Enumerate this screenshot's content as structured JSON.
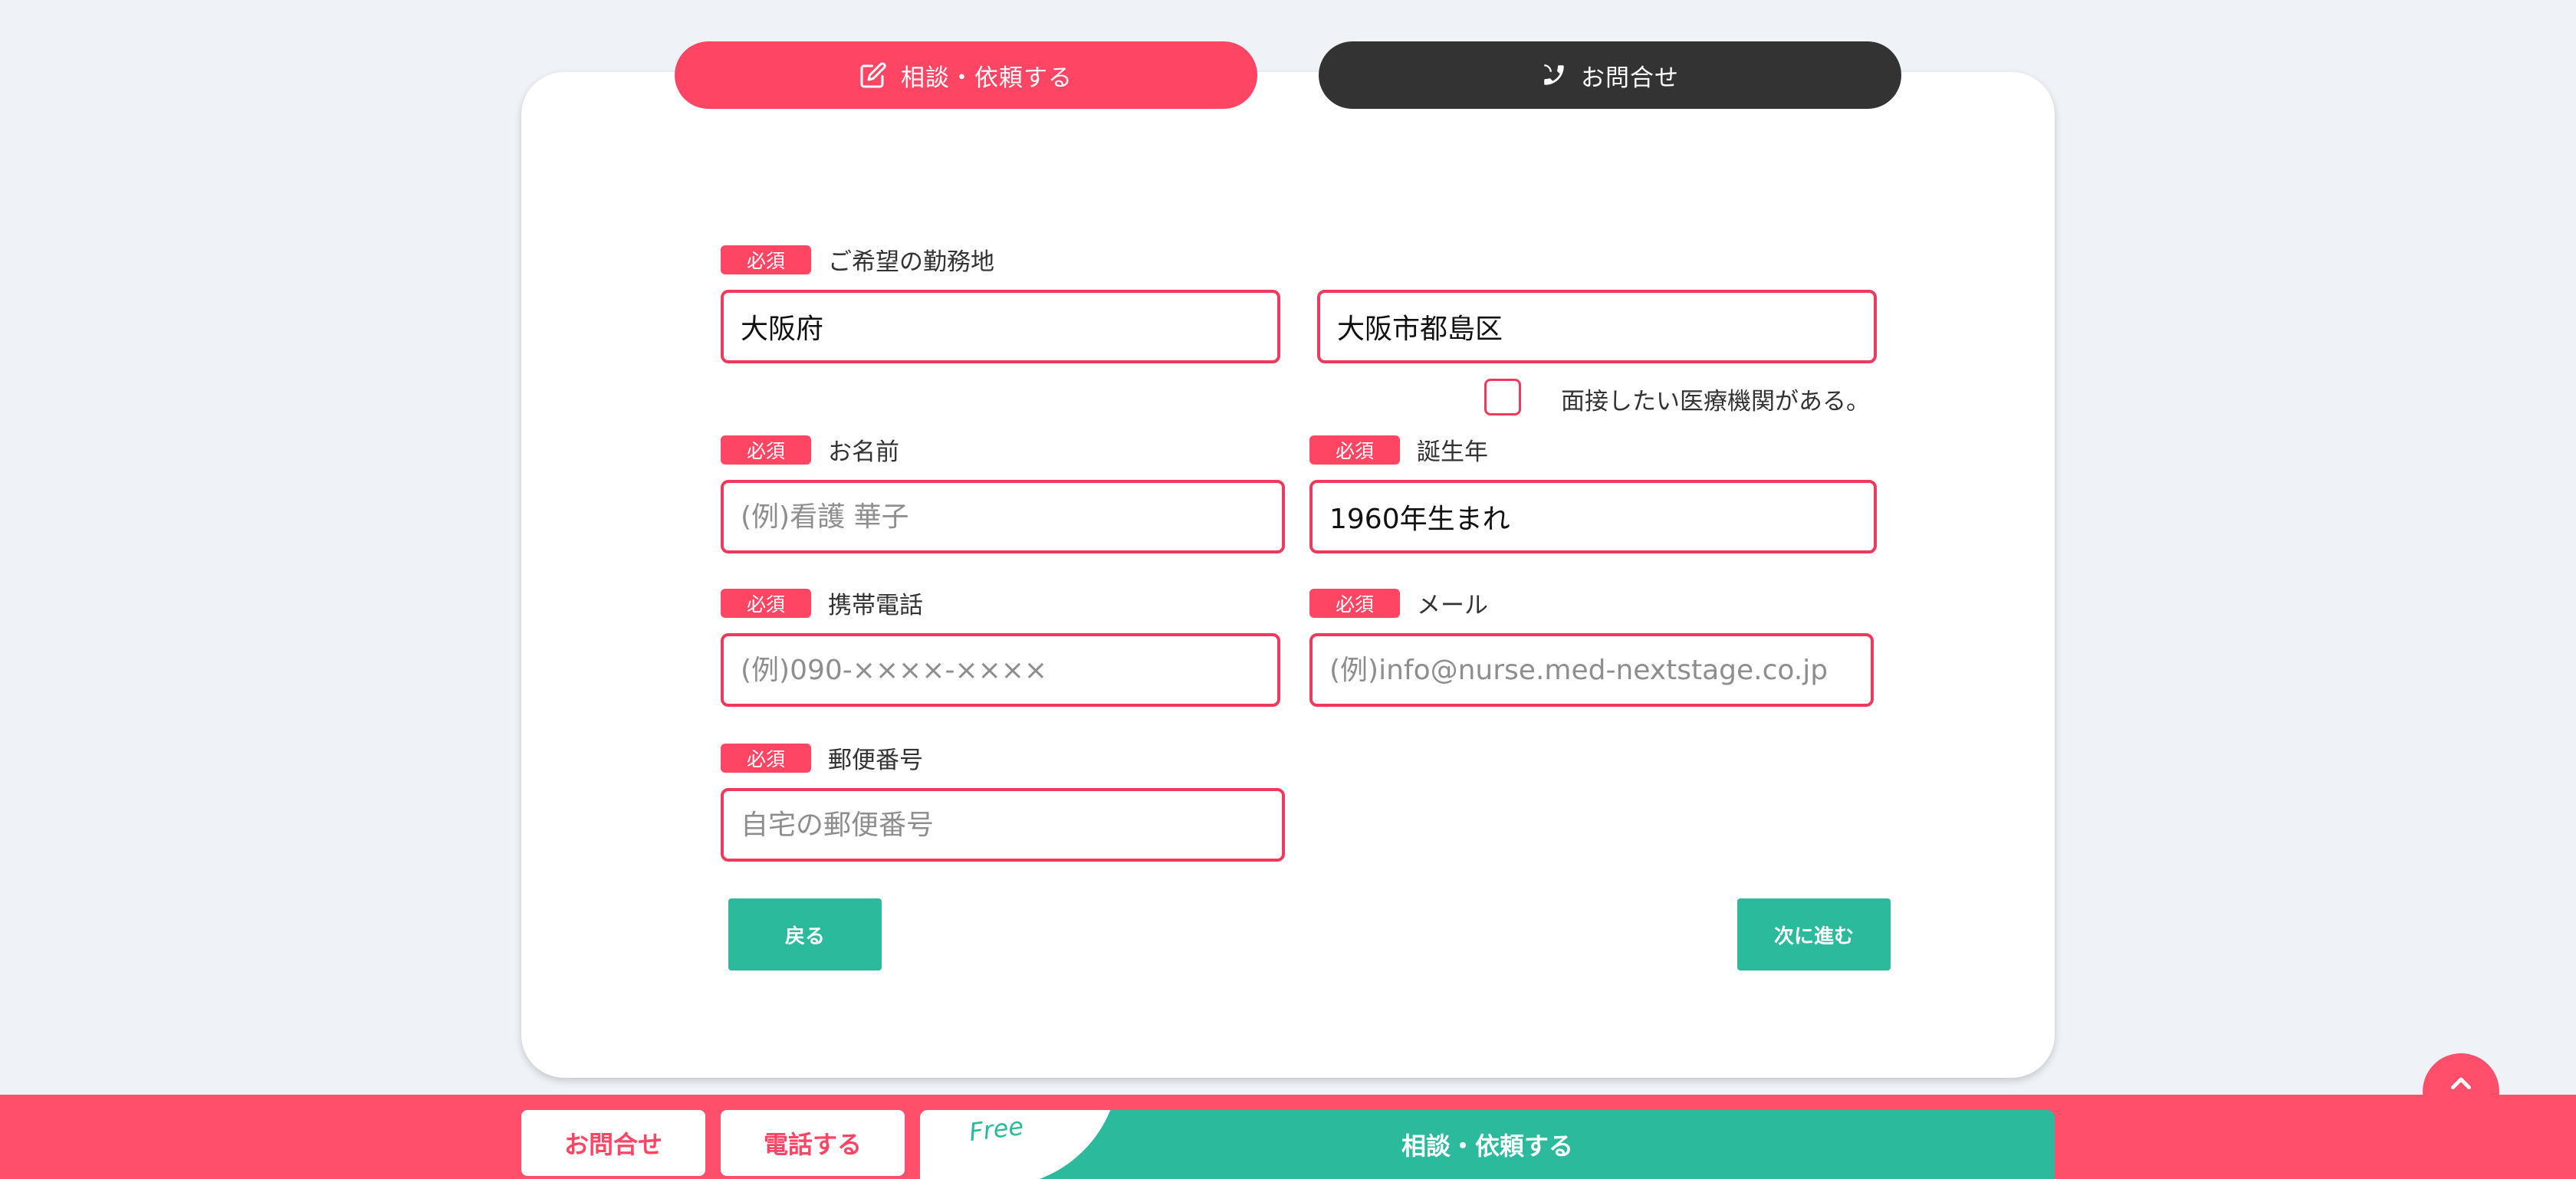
{
  "tabs": {
    "consult_label": "相談・依頼する",
    "inquiry_label": "お問合せ"
  },
  "form": {
    "required_badge": "必須",
    "workplace": {
      "label": "ご希望の勤務地",
      "prefecture_value": "大阪府",
      "city_value": "大阪市都島区"
    },
    "interview_checkbox": {
      "label": "面接したい医療機関がある。",
      "checked": false
    },
    "name": {
      "label": "お名前",
      "placeholder": "(例)看護 華子",
      "value": ""
    },
    "birth_year": {
      "label": "誕生年",
      "value": "1960年生まれ"
    },
    "mobile": {
      "label": "携帯電話",
      "placeholder": "(例)090-××××-××××",
      "value": ""
    },
    "email": {
      "label": "メール",
      "placeholder": "(例)info@nurse.med-nextstage.co.jp",
      "value": ""
    },
    "postal": {
      "label": "郵便番号",
      "placeholder": "自宅の郵便番号",
      "value": ""
    },
    "back_button": "戻る",
    "next_button": "次に進む"
  },
  "bottom_bar": {
    "inquiry_label": "お問合せ",
    "call_label": "電話する",
    "free_tag": "Free",
    "consult_label": "相談・依頼する"
  },
  "icons": {
    "consult": "edit-icon",
    "inquiry": "phone-icon",
    "scroll_top": "chevron-up-icon"
  },
  "colors": {
    "accent": "#ff4564",
    "dark": "#333333",
    "green": "#2bba9b",
    "background": "#eff3f7"
  }
}
